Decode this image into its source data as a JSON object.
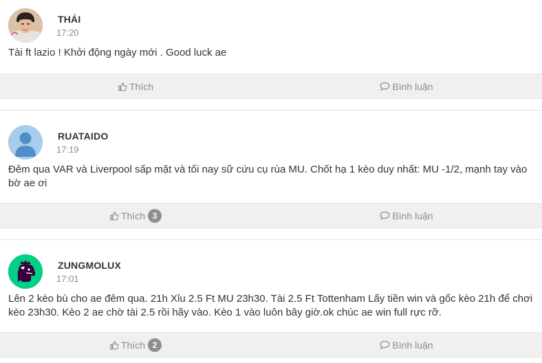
{
  "posts": [
    {
      "author": "THÁI",
      "time": "17:20",
      "content": "Tài ft lazio ! Khởi động ngày mới . Good luck ae",
      "like_label": "Thích",
      "like_count": "",
      "comment_label": "Bình luận"
    },
    {
      "author": "RUATAIDO",
      "time": "17:19",
      "content": "Đêm qua VAR và Liverpool sấp mặt và tối nay sữ cứu cụ rùa MU. Chốt hạ 1 kèo duy nhất: MU -1/2, mạnh tay vào bờ ae ơi",
      "like_label": "Thích",
      "like_count": "3",
      "comment_label": "Bình luận"
    },
    {
      "author": "ZUNGMOLUX",
      "time": "17:01",
      "content": "Lên 2 kèo bù cho ae đêm qua. 21h Xỉu 2.5 Ft MU 23h30. Tài 2.5 Ft Tottenham Lấy tiền win và gốc kèo 21h để chơi kèo 23h30. Kèo 2 ae chờ tài 2.5 rồi hãy vào. Kèo 1 vào luôn bây giờ.ok chúc ae win full rực rỡ.",
      "like_label": "Thích",
      "like_count": "2",
      "comment_label": "Bình luận"
    }
  ],
  "icons": {
    "like": "thumbs-up-icon",
    "comment": "comment-bubble-icon"
  },
  "colors": {
    "action_bar": "#f0f0f0",
    "badge": "#8f8f8f",
    "premier_league_green": "#00d084",
    "premier_league_purple": "#38003c"
  }
}
